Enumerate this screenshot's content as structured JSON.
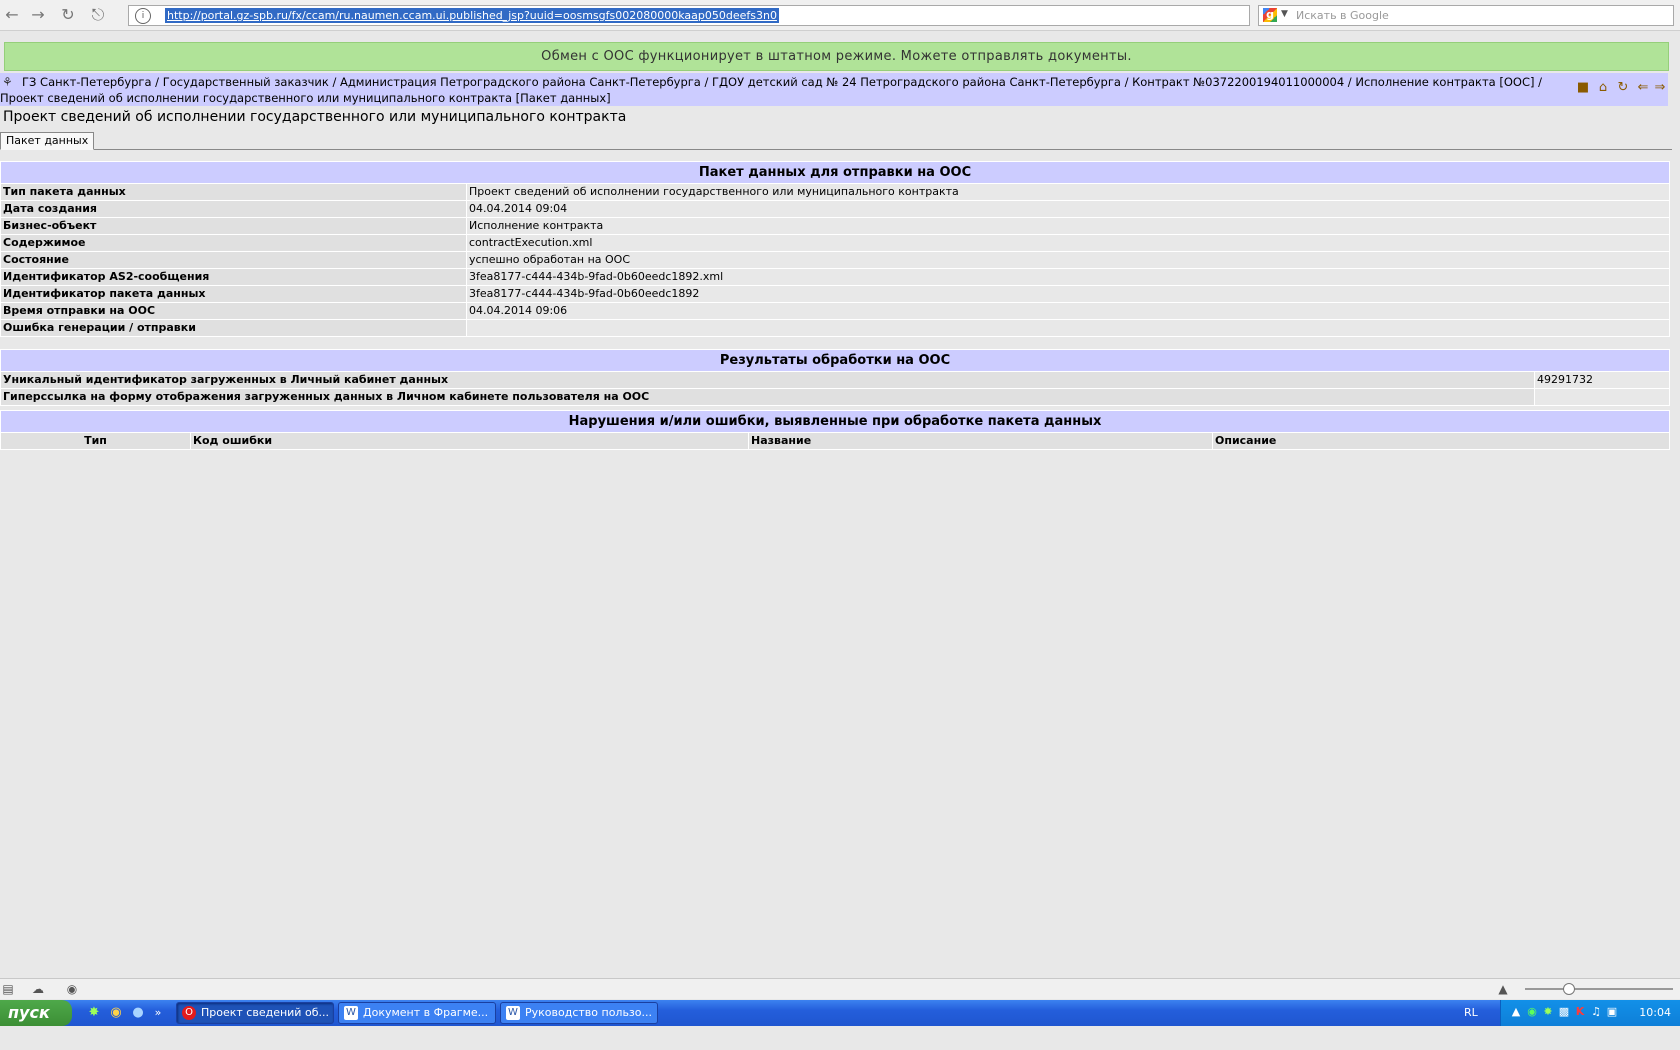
{
  "browser": {
    "url": "http://portal.gz-spb.ru/fx/ccam/ru.naumen.ccam.ui.published_jsp?uuid=oosmsgfs002080000kaap050deefs3n0",
    "search_placeholder": "Искать в Google"
  },
  "banner": {
    "text": "Обмен с ООС функционирует в штатном режиме. Можете отправлять документы."
  },
  "breadcrumb": {
    "text": "ГЗ Санкт-Петербурга / Государственный заказчик / Администрация Петроградского района Санкт-Петербурга / ГДОУ детский сад № 24 Петроградского района Санкт-Петербурга / Контракт №0372200194011000004 / Исполнение контракта [ООС] / Проект сведений об исполнении государственного или муниципального контракта [Пакет данных]"
  },
  "page": {
    "title": "Проект сведений об исполнении государственного или муниципального контракта",
    "tab": "Пакет данных"
  },
  "package": {
    "header": "Пакет данных для отправки на ООС",
    "rows": [
      {
        "label": "Тип пакета данных",
        "value": "Проект сведений об исполнении государственного или муниципального контракта"
      },
      {
        "label": "Дата создания",
        "value": "04.04.2014 09:04"
      },
      {
        "label": "Бизнес-объект",
        "value": "Исполнение контракта"
      },
      {
        "label": "Содержимое",
        "value": "contractExecution.xml"
      },
      {
        "label": "Состояние",
        "value": "успешно обработан на ООС"
      },
      {
        "label": "Идентификатор AS2-сообщения",
        "value": "3fea8177-c444-434b-9fad-0b60eedc1892.xml"
      },
      {
        "label": "Идентификатор пакета данных",
        "value": "3fea8177-c444-434b-9fad-0b60eedc1892"
      },
      {
        "label": "Время отправки на ООС",
        "value": "04.04.2014 09:06"
      },
      {
        "label": "Ошибка генерации / отправки",
        "value": ""
      }
    ]
  },
  "results": {
    "header": "Результаты обработки на ООС",
    "rows": [
      {
        "label": "Уникальный идентификатор загруженных в Личный кабинет данных",
        "value": "49291732"
      },
      {
        "label": "Гиперссылка на форму отображения загруженных данных в Личном кабинете пользователя на ООС",
        "value": ""
      }
    ]
  },
  "violations": {
    "header": "Нарушения и/или ошибки, выявленные при обработке пакета данных",
    "columns": [
      "Тип",
      "Код ошибки",
      "Название",
      "Описание"
    ]
  },
  "taskbar": {
    "start_label": "пуск",
    "tasks": [
      {
        "label": "Проект сведений об..."
      },
      {
        "label": "Документ в Фрагме..."
      },
      {
        "label": "Руководство пользо..."
      }
    ],
    "lang": "RL",
    "clock": "10:04"
  },
  "colors": {
    "banner": "#b0e398",
    "section_header": "#ccccff",
    "taskbar": "#245edb",
    "start": "#3c8f35"
  }
}
